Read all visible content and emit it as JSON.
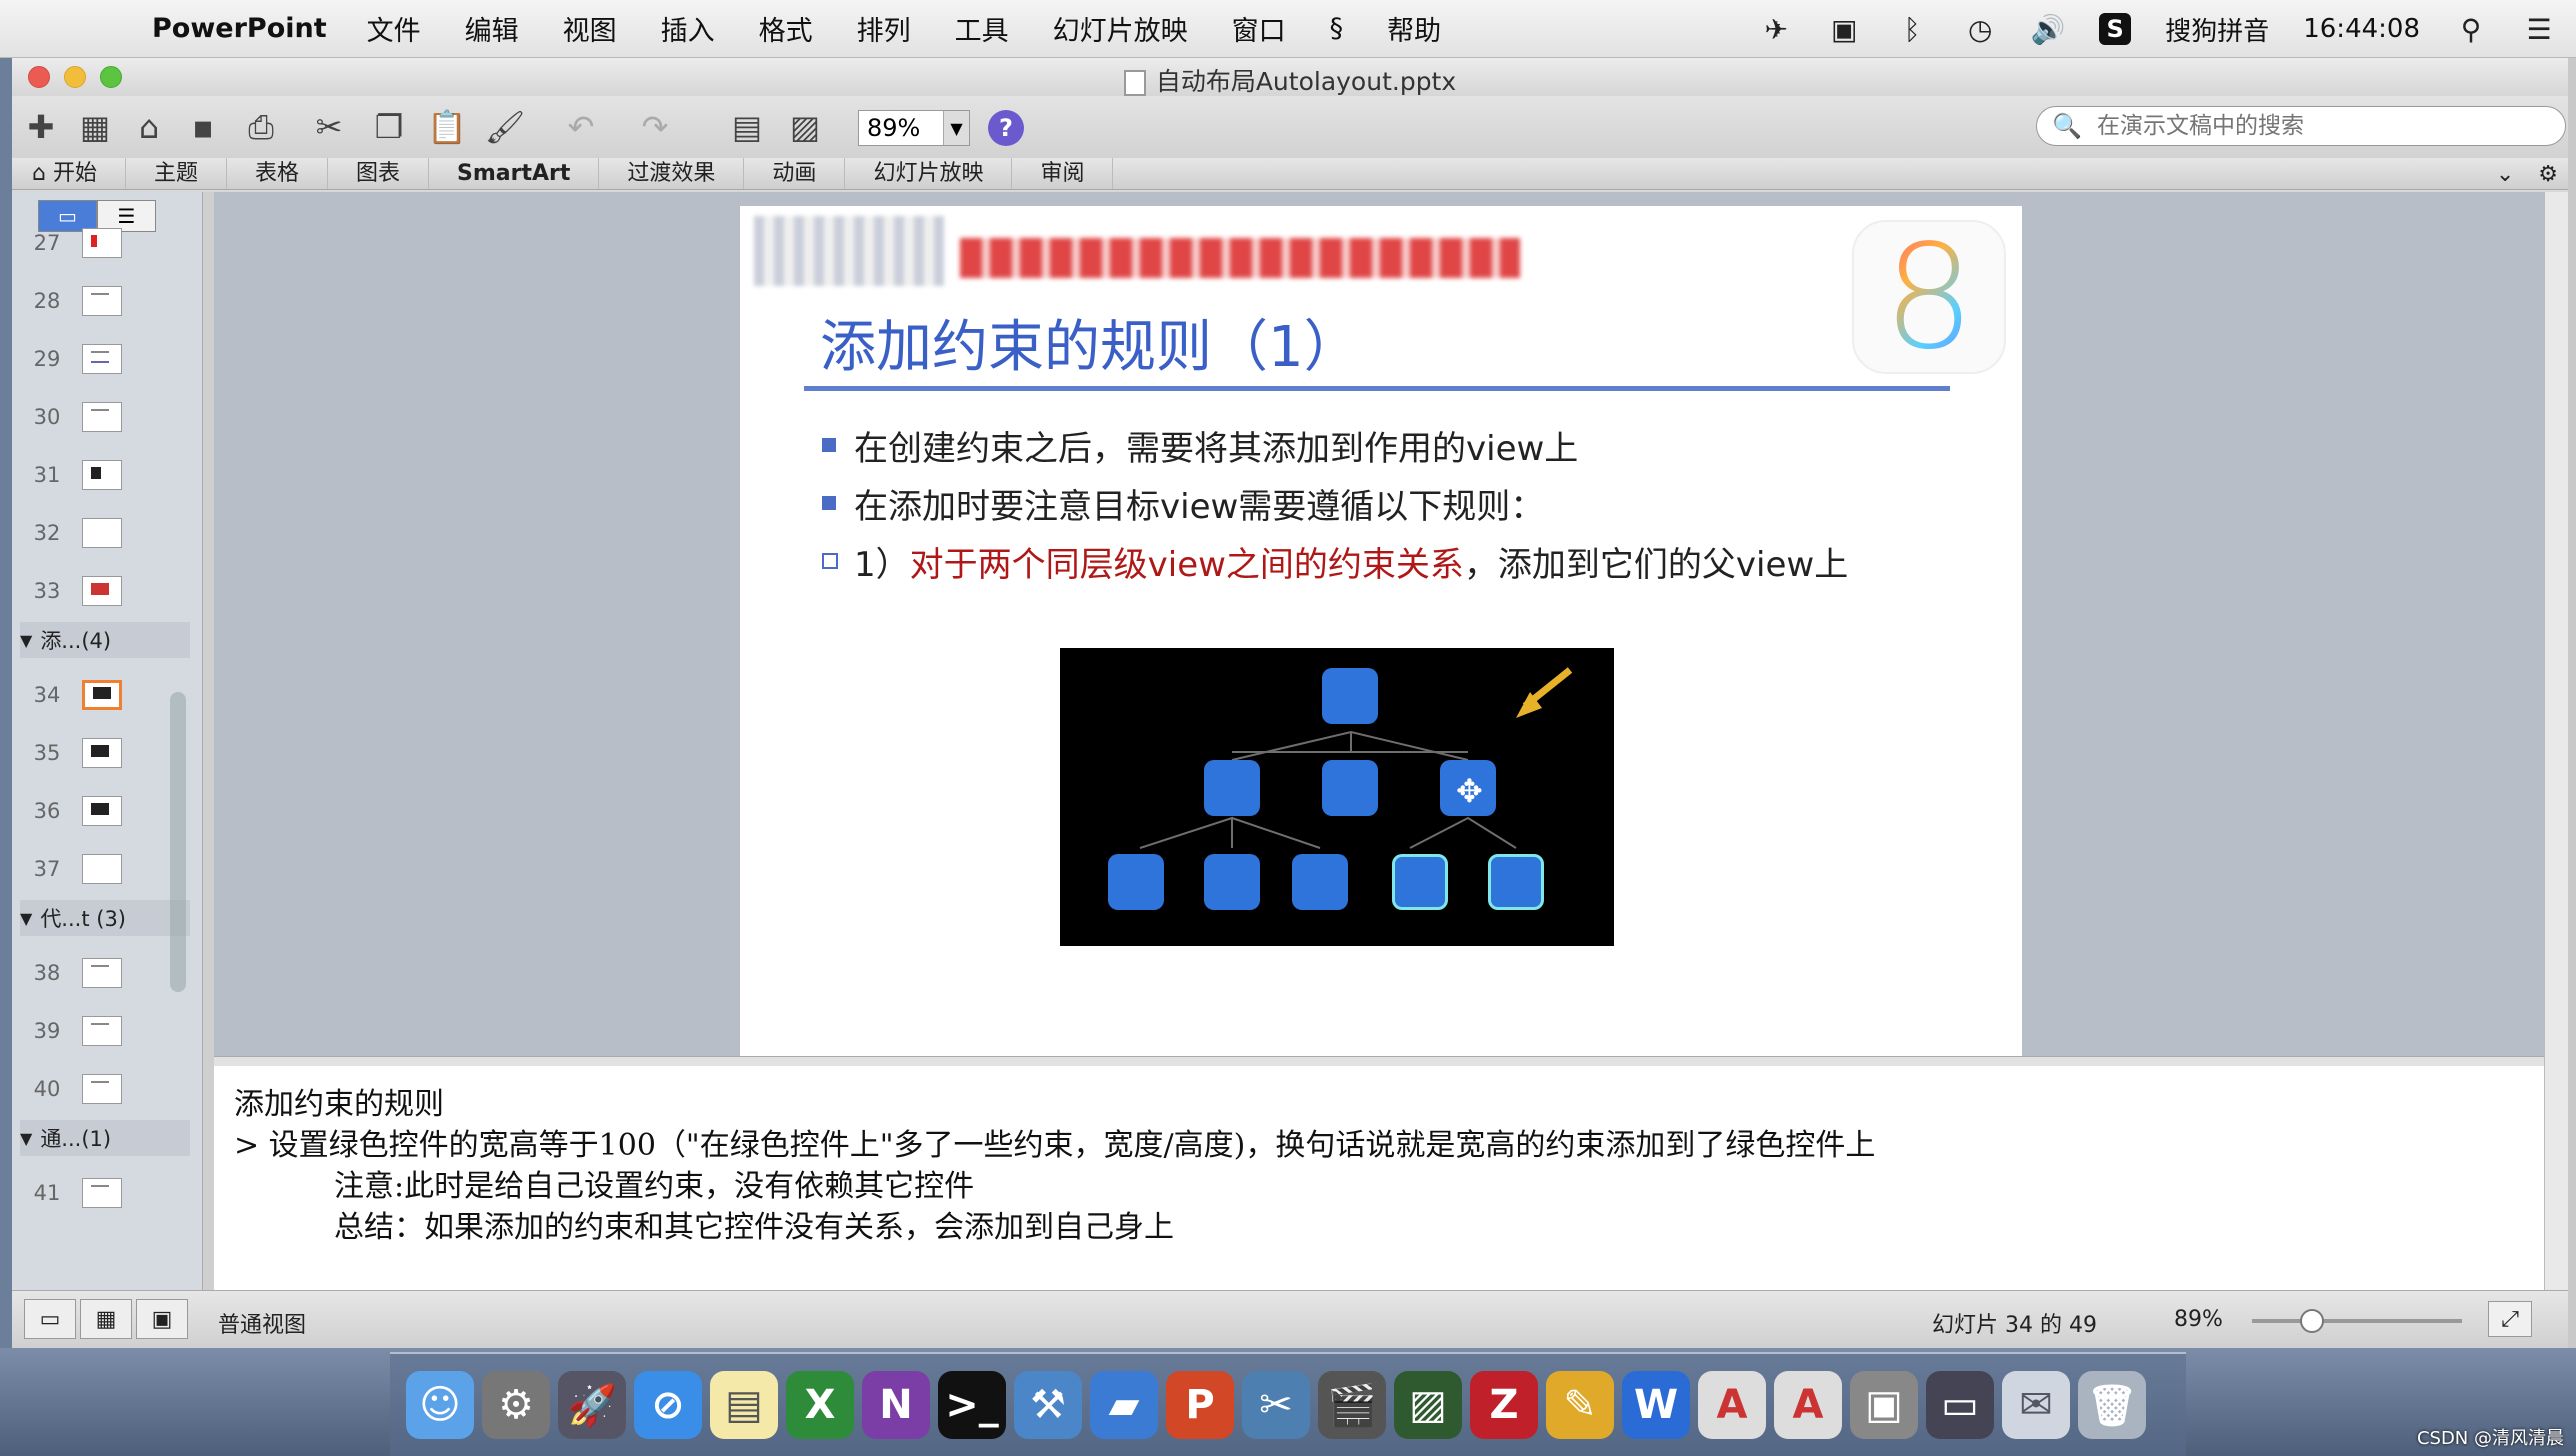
{
  "menubar": {
    "app_name": "PowerPoint",
    "menus": [
      "文件",
      "编辑",
      "视图",
      "插入",
      "格式",
      "排列",
      "工具",
      "幻灯片放映",
      "窗口",
      "帮助"
    ],
    "ime_name": "搜狗拼音",
    "clock": "16:44:08"
  },
  "window": {
    "title": "自动布局Autolayout.pptx"
  },
  "toolbar": {
    "zoom": "89%",
    "search_placeholder": "在演示文稿中的搜索"
  },
  "ribbon": {
    "tabs": [
      "开始",
      "主题",
      "表格",
      "图表",
      "SmartArt",
      "过渡效果",
      "动画",
      "幻灯片放映",
      "审阅"
    ]
  },
  "sidebar": {
    "thumbs_a": [
      "27",
      "28",
      "29",
      "30",
      "31",
      "32",
      "33"
    ],
    "section1": "添...(4)",
    "thumbs_b": [
      "34",
      "35",
      "36",
      "37"
    ],
    "section2": "代...t (3)",
    "thumbs_c": [
      "38",
      "39",
      "40"
    ],
    "section3": "通...(1)",
    "thumbs_d": [
      "41"
    ]
  },
  "slide": {
    "title": "添加约束的规则（1）",
    "bullets": [
      "在创建约束之后，需要将其添加到作用的view上",
      "在添加时要注意目标view需要遵循以下规则："
    ],
    "sub_prefix": "1）",
    "sub_red": "对于两个同层级view之间的约束关系",
    "sub_suffix": "，添加到它们的父view上",
    "badge": "8"
  },
  "notes": {
    "line1": "添加约束的规则",
    "line2": "> 设置绿色控件的宽高等于100（\"在绿色控件上\"多了一些约束，宽度/高度)，换句话说就是宽高的约束添加到了绿色控件上",
    "line3": "注意:此时是给自己设置约束，没有依赖其它控件",
    "line4": "总结：如果添加的约束和其它控件没有关系，会添加到自己身上"
  },
  "statusbar": {
    "view_name": "普通视图",
    "slide_pos": "幻灯片 34 的 49",
    "zoom": "89%"
  },
  "watermark": "CSDN @清风清晨",
  "colors": {
    "title_blue": "#3a60c8",
    "red_text": "#b01818",
    "node_blue": "#2f74db",
    "outline_cyan": "#7fe7e7"
  }
}
